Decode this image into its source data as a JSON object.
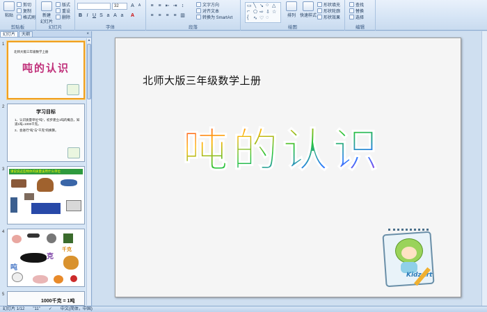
{
  "ribbon": {
    "clipboard": {
      "paste": "粘贴",
      "cut": "剪切",
      "copy": "复制",
      "format_painter": "格式刷",
      "label": "剪贴板"
    },
    "slides": {
      "new_slide": "新建",
      "new_slide_2": "幻灯片",
      "layout": "版式",
      "reset": "重设",
      "delete": "删除",
      "label": "幻灯片"
    },
    "font": {
      "font_size": "32",
      "label": "字体"
    },
    "paragraph": {
      "text_direction": "文字方向",
      "align_text": "对齐文本",
      "smartart": "转换为 SmartArt",
      "label": "段落"
    },
    "drawing": {
      "arrange": "排列",
      "quick_styles": "快速样式",
      "shape_fill": "形状填充",
      "shape_outline": "形状轮廓",
      "shape_effects": "形状效果",
      "label": "绘图"
    },
    "editing": {
      "find": "查找",
      "replace": "替换",
      "select": "选择",
      "label": "编辑"
    }
  },
  "pane": {
    "tab_slides": "幻灯片",
    "tab_outline": "大纲",
    "close": "×"
  },
  "thumbnails": [
    {
      "num": "1",
      "header": "北师大版三年级数学上册",
      "title": "吨的认识"
    },
    {
      "num": "2",
      "heading": "学习目标",
      "line1": "1、认识质量单位“吨”，初步建立1吨的概念，知道1吨=1000千克。",
      "line2": "2、会进行“吨”与“千克”的换算。"
    },
    {
      "num": "3",
      "banner": "请说说这些物体的质量该用什么单位"
    },
    {
      "num": "4",
      "char_dun": "吨",
      "char_ke": "克",
      "char_qianke": "千克"
    },
    {
      "num": "5",
      "equation": "1000千克 = 1吨"
    }
  ],
  "slide": {
    "subtitle": "北师大版三年级数学上册",
    "title": "吨的认识",
    "logo_text": "KidzArt"
  },
  "status": {
    "slide_info": "幻灯片 1/12",
    "theme": "\"11\"",
    "language": "中文(简体，中国)"
  }
}
